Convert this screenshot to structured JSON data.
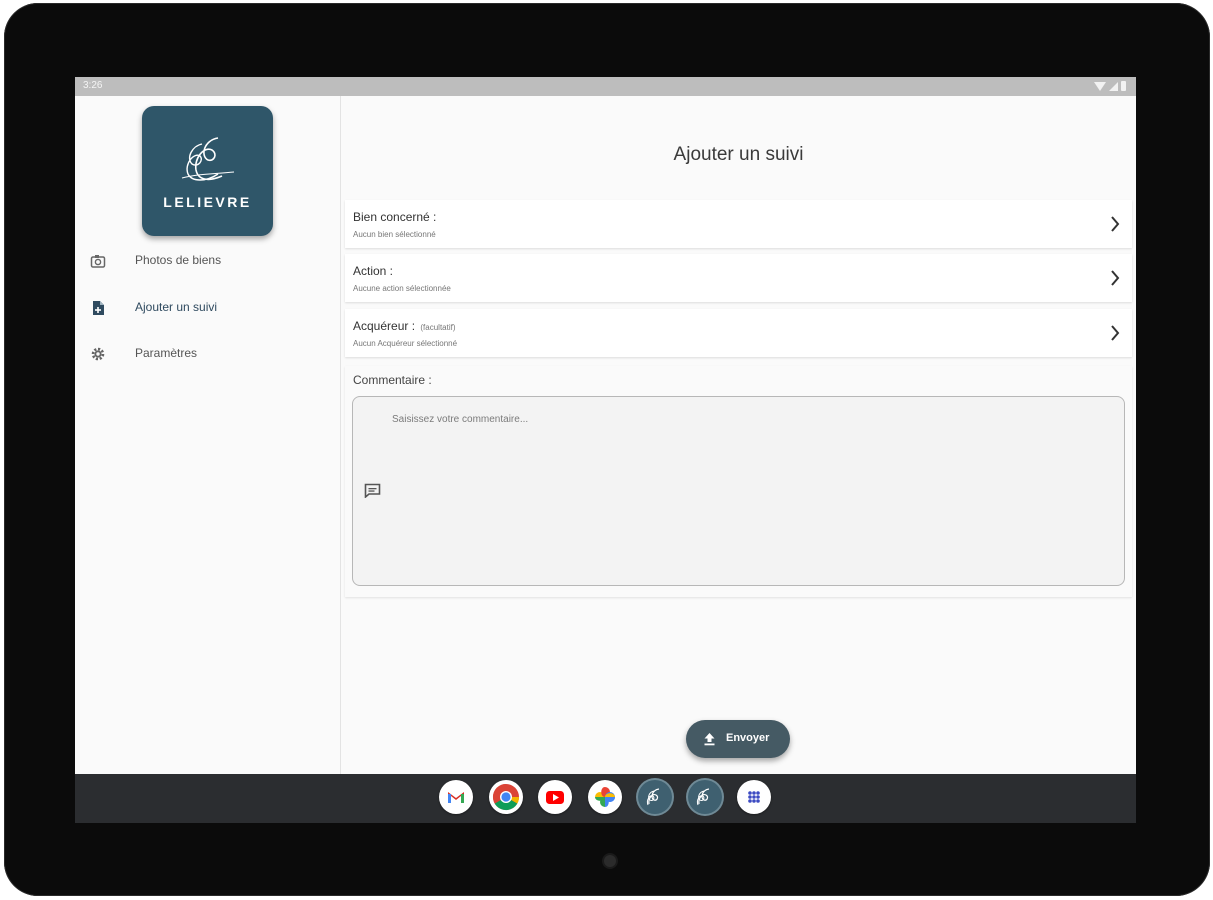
{
  "status_bar": {
    "time": "3:26"
  },
  "brand": {
    "name": "LELIEVRE",
    "color": "#2f5669"
  },
  "sidebar": {
    "items": [
      {
        "label": "Photos de biens",
        "icon": "camera-icon",
        "active": false
      },
      {
        "label": "Ajouter un suivi",
        "icon": "file-add-icon",
        "active": true
      },
      {
        "label": "Paramètres",
        "icon": "gear-icon",
        "active": false
      }
    ]
  },
  "main": {
    "title": "Ajouter un suivi",
    "rows": [
      {
        "label": "Bien concerné :",
        "subtitle": "Aucun bien sélectionné"
      },
      {
        "label": "Action :",
        "subtitle": "Aucune action sélectionnée"
      },
      {
        "label": "Acquéreur :",
        "optional": "(facultatif)",
        "subtitle": "Aucun Acquéreur sélectionné"
      }
    ],
    "comment": {
      "label": "Commentaire :",
      "placeholder": "Saisissez votre commentaire..."
    },
    "send_button": {
      "label": "Envoyer",
      "color": "#455a64"
    }
  },
  "dock": {
    "apps": [
      "gmail-icon",
      "chrome-icon",
      "youtube-icon",
      "photos-icon",
      "lelievre-app-icon",
      "lelievre-app-icon",
      "app-drawer-icon"
    ]
  }
}
